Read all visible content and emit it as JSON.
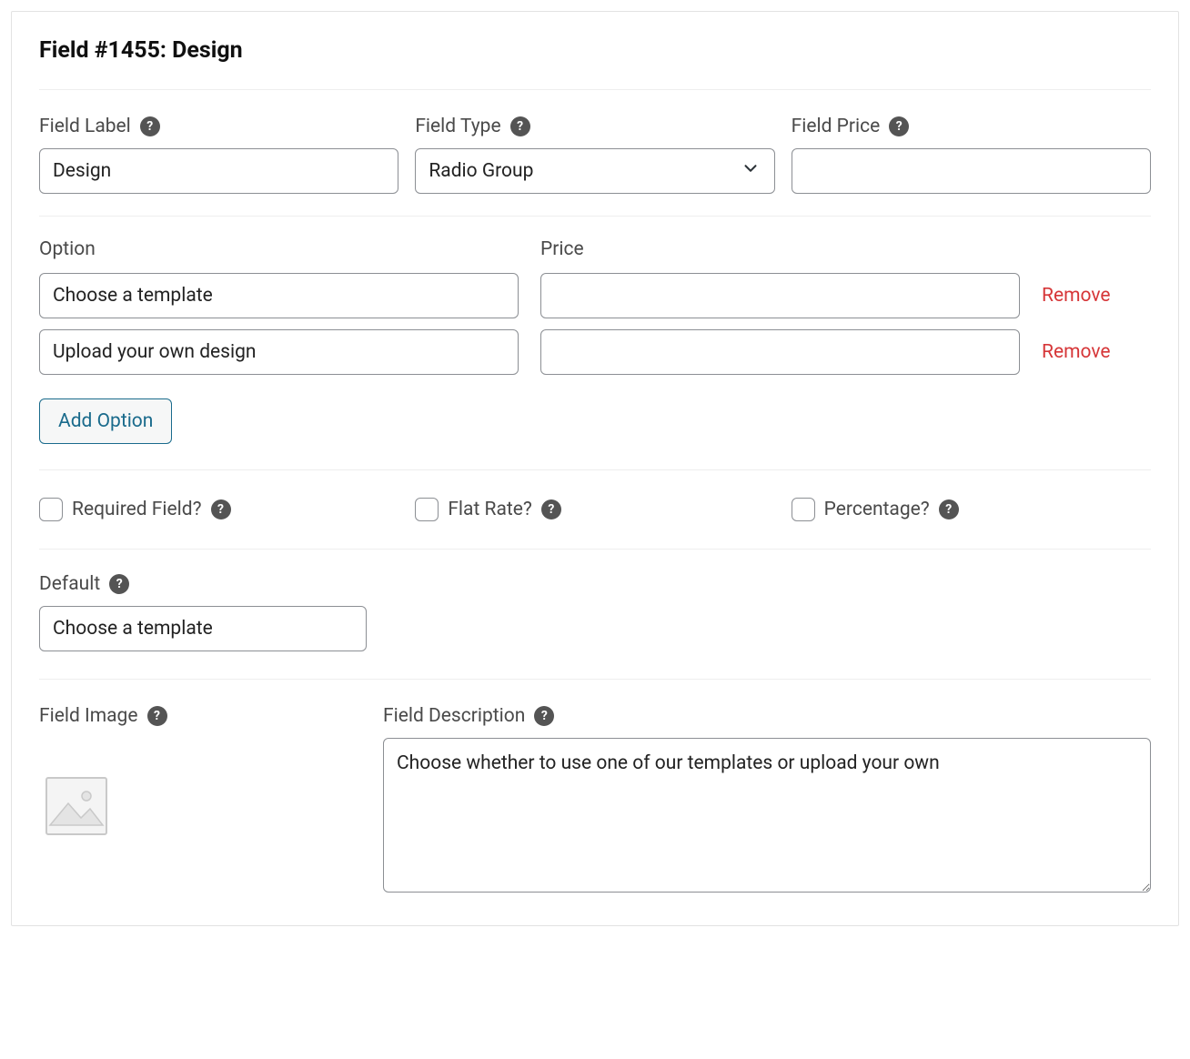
{
  "title": "Field #1455: Design",
  "labels": {
    "field_label": "Field Label",
    "field_type": "Field Type",
    "field_price": "Field Price",
    "option": "Option",
    "price": "Price",
    "remove": "Remove",
    "add_option": "Add Option",
    "required": "Required Field?",
    "flat_rate": "Flat Rate?",
    "percentage": "Percentage?",
    "default": "Default",
    "field_image": "Field Image",
    "field_description": "Field Description"
  },
  "field_label_value": "Design",
  "field_type_value": "Radio Group",
  "field_price_value": "",
  "options": [
    {
      "name": "Choose a template",
      "price": ""
    },
    {
      "name": "Upload your own design",
      "price": ""
    }
  ],
  "checks": {
    "required": false,
    "flat_rate": false,
    "percentage": false
  },
  "default_value": "Choose a template",
  "description_value": "Choose whether to use one of our templates or upload your own"
}
